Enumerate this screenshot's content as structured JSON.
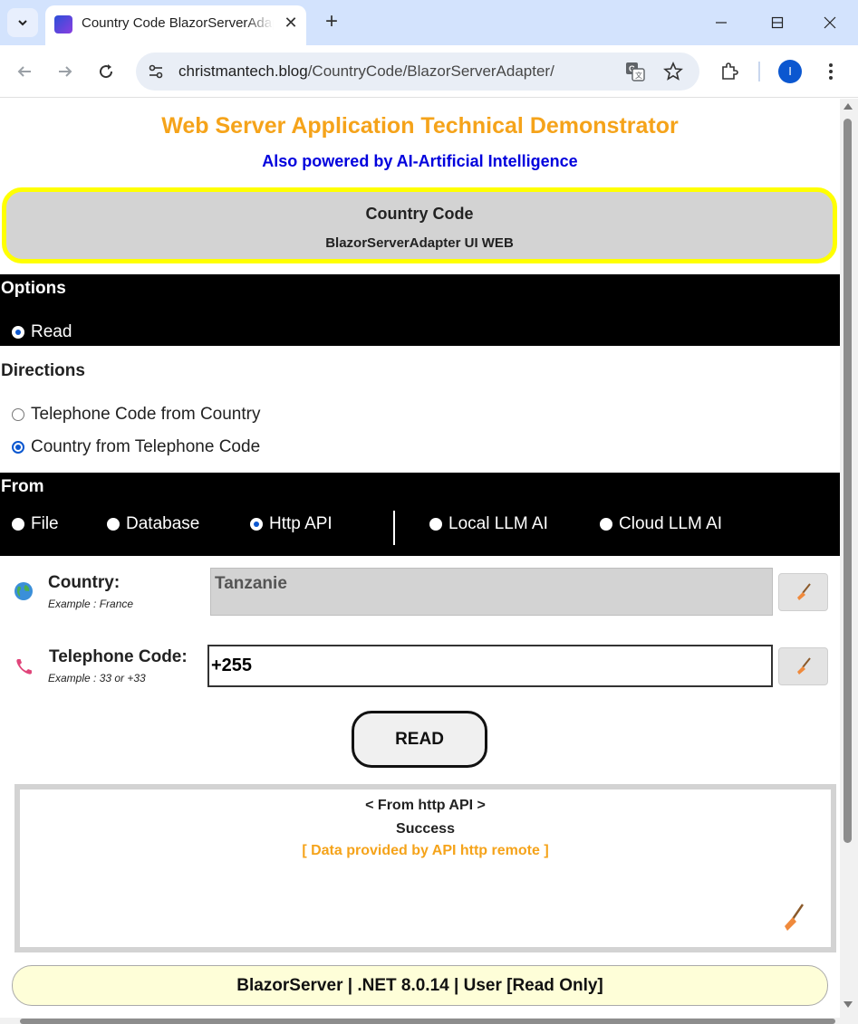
{
  "browser": {
    "tab_title": "Country Code BlazorServerAdapter",
    "url_host": "christmantech.blog",
    "url_path": "/CountryCode/BlazorServerAdapter/",
    "profile_initial": "I"
  },
  "page": {
    "title": "Web Server Application Technical Demonstrator",
    "subtitle": "Also powered by AI-Artificial Intelligence",
    "banner_title": "Country Code",
    "banner_subtitle": "BlazorServerAdapter UI WEB"
  },
  "options": {
    "label": "Options",
    "read_label": "Read"
  },
  "directions": {
    "label": "Directions",
    "items": [
      {
        "label": "Telephone Code from Country",
        "checked": false
      },
      {
        "label": "Country from Telephone Code",
        "checked": true
      }
    ]
  },
  "from": {
    "label": "From",
    "items": [
      {
        "label": "File",
        "checked": false
      },
      {
        "label": "Database",
        "checked": false
      },
      {
        "label": "Http API",
        "checked": true
      },
      {
        "label": "Local LLM AI",
        "checked": false
      },
      {
        "label": "Cloud LLM AI",
        "checked": false
      }
    ]
  },
  "country": {
    "label": "Country:",
    "example": "Example : France",
    "value": "Tanzanie"
  },
  "telephone": {
    "label": "Telephone Code:",
    "example": "Example : 33 or +33",
    "value": "+255"
  },
  "read_button": "READ",
  "result": {
    "source": "< From http API >",
    "status": "Success",
    "note": "[ Data provided by API http remote ]"
  },
  "footer": "BlazorServer | .NET 8.0.14 | User [Read Only]",
  "colors": {
    "title": "#f5a31a",
    "subtitle": "#0000dd",
    "banner_border": "#ffff00",
    "footer_bg": "#fefed8"
  }
}
